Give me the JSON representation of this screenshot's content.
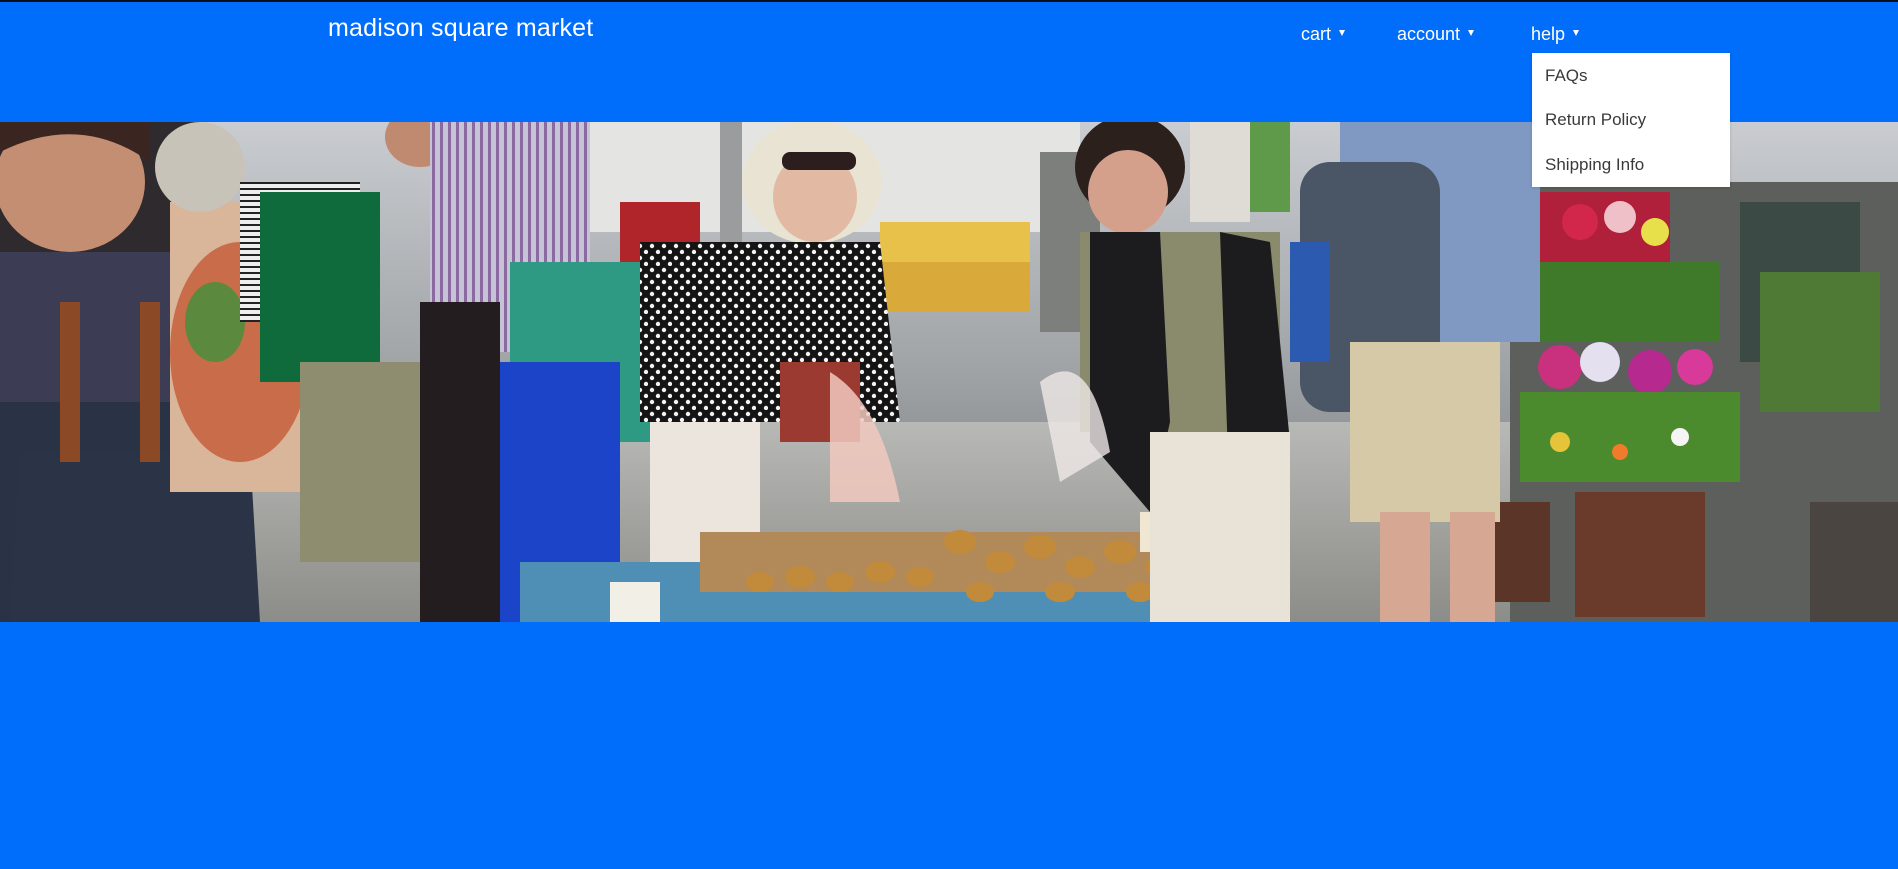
{
  "site": {
    "title": "madison square market"
  },
  "nav": {
    "items": [
      {
        "label": "cart",
        "icon": "caret-down-icon"
      },
      {
        "label": "account",
        "icon": "caret-down-icon"
      },
      {
        "label": "help",
        "icon": "caret-down-icon"
      }
    ]
  },
  "help_menu": {
    "items": [
      {
        "label": "FAQs"
      },
      {
        "label": "Return Policy"
      },
      {
        "label": "Shipping Info"
      }
    ]
  },
  "hero": {
    "scene": "farmers-market-photo"
  },
  "colors": {
    "brand": "#006dfb",
    "nav_text": "#ffffff",
    "menu_bg": "#ffffff",
    "menu_text": "#3a3a3a"
  }
}
